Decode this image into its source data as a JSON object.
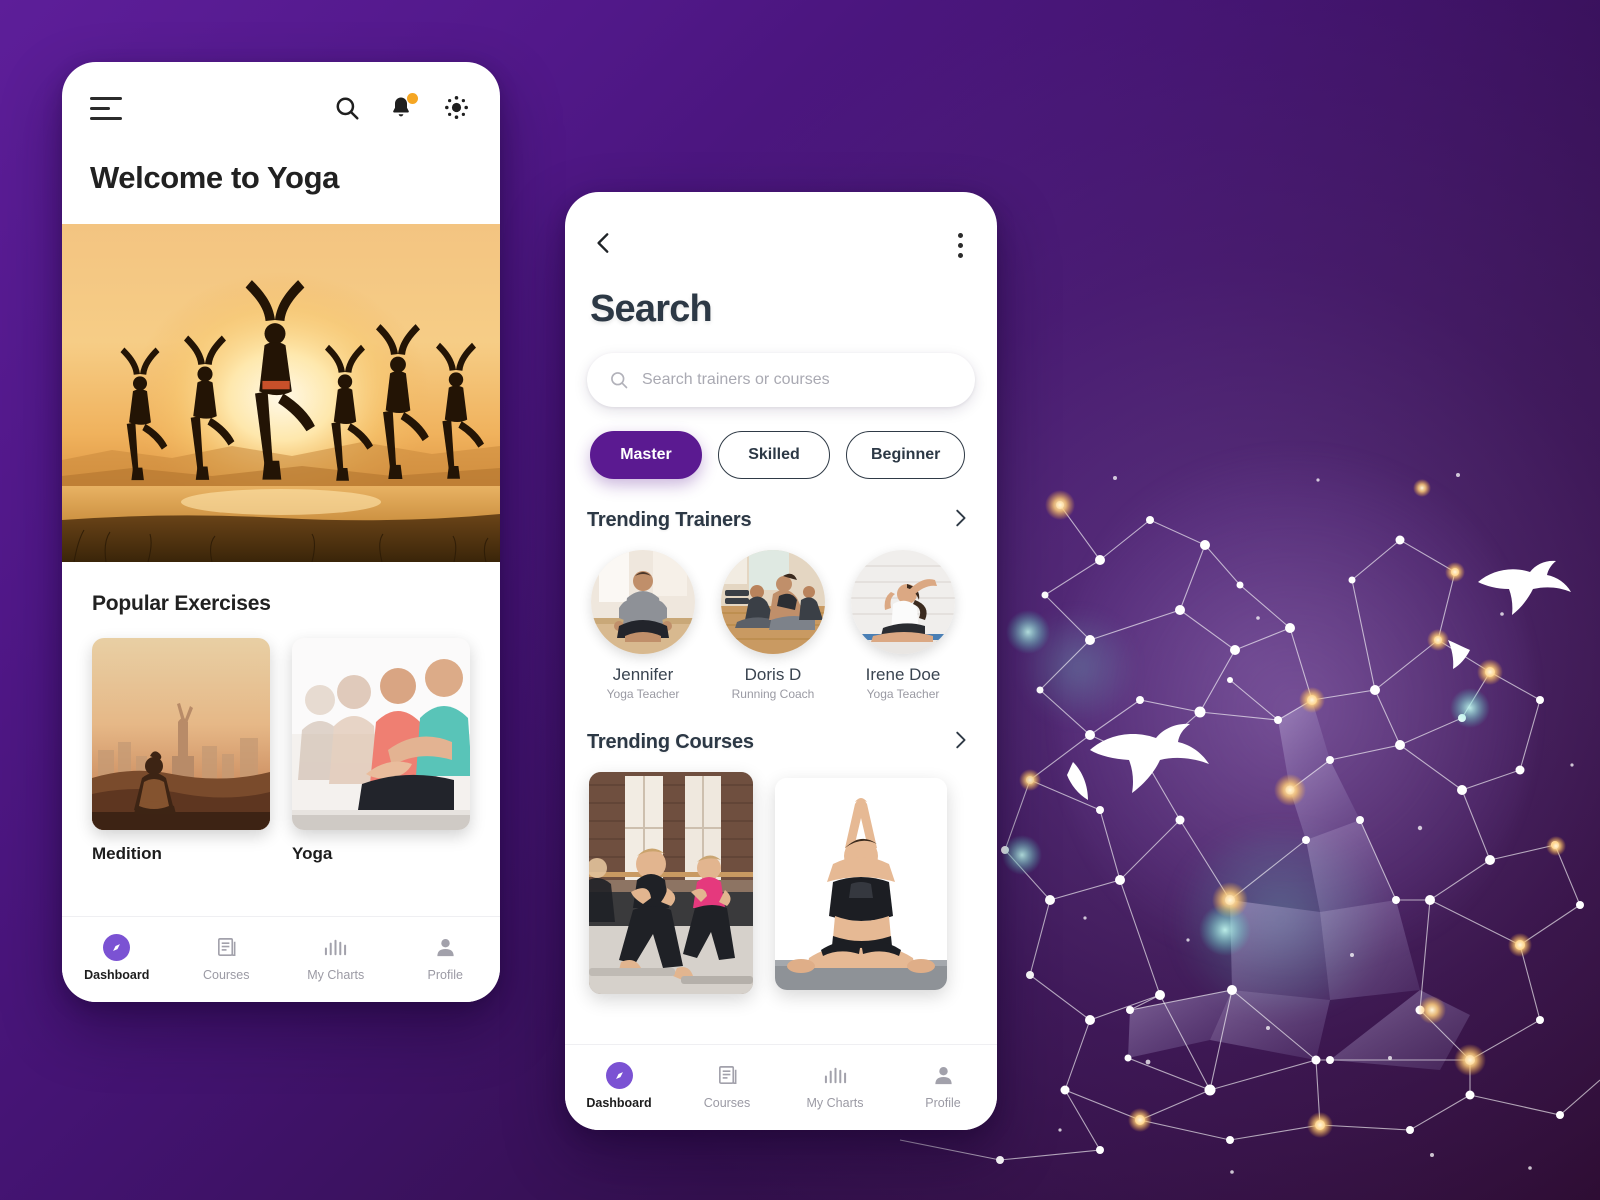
{
  "theme": {
    "brand_purple": "#5b1a91",
    "nav_active_purple": "#7b52d3",
    "badge_orange": "#f5a623",
    "title_navy": "#2c3845",
    "muted_grey": "#9b9aa4"
  },
  "home": {
    "title": "Welcome to Yoga",
    "icons": {
      "menu": "hamburger-icon",
      "search": "search-icon",
      "bell": "bell-icon",
      "settings": "settings-icon"
    },
    "hero_alt": "Six yoga practitioners in tree pose silhouetted against a golden sunset over water",
    "popular": {
      "heading": "Popular Exercises",
      "cards": [
        {
          "label": "Medition",
          "alt": "Woman meditating on rooftop at sunrise with city skyline and monument"
        },
        {
          "label": "Yoga",
          "alt": "Row of people seated cross-legged meditating in a bright studio"
        }
      ]
    },
    "bottom_nav": [
      {
        "label": "Dashboard",
        "icon": "compass-icon",
        "active": true
      },
      {
        "label": "Courses",
        "icon": "document-icon",
        "active": false
      },
      {
        "label": "My Charts",
        "icon": "bar-chart-icon",
        "active": false
      },
      {
        "label": "Profile",
        "icon": "person-icon",
        "active": false
      }
    ]
  },
  "search": {
    "title": "Search",
    "back_icon": "chevron-left-icon",
    "more_icon": "kebab-menu-icon",
    "search_field": {
      "value": "",
      "placeholder": "Search trainers or courses",
      "icon": "search-icon"
    },
    "filters": [
      {
        "label": "Master",
        "active": true
      },
      {
        "label": "Skilled",
        "active": false
      },
      {
        "label": "Beginner",
        "active": false
      }
    ],
    "trending_trainers": {
      "heading": "Trending Trainers",
      "see_all_icon": "chevron-right-icon",
      "items": [
        {
          "name": "Jennifer",
          "role": "Yoga Teacher",
          "alt": "Man seated in lotus meditation pose in a bright room"
        },
        {
          "name": "Doris D",
          "role": "Running Coach",
          "alt": "Group of people in upward dog pose on wooden studio floor"
        },
        {
          "name": "Irene Doe",
          "role": "Yoga Teacher",
          "alt": "Woman performing a seated side bend stretch on a blue mat"
        }
      ]
    },
    "trending_courses": {
      "heading": "Trending Courses",
      "see_all_icon": "chevron-right-icon",
      "items": [
        {
          "alt": "Three women in a lunge stance during a studio fitness class with brick walls"
        },
        {
          "alt": "Woman in seated eagle-arm pose on a grey mat against white background"
        }
      ]
    },
    "bottom_nav": [
      {
        "label": "Dashboard",
        "icon": "compass-icon",
        "active": true
      },
      {
        "label": "Courses",
        "icon": "document-icon",
        "active": false
      },
      {
        "label": "My Charts",
        "icon": "bar-chart-icon",
        "active": false
      },
      {
        "label": "Profile",
        "icon": "person-icon",
        "active": false
      }
    ]
  }
}
